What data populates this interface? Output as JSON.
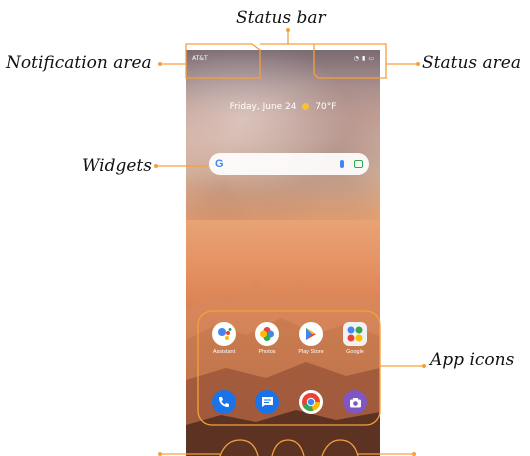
{
  "callouts": {
    "status_bar": "Status bar",
    "notification_area": "Notification area",
    "status_area": "Status area",
    "widgets": "Widgets",
    "app_icons": "App icons"
  },
  "phone": {
    "carrier": "AT&T",
    "date": "Friday, June 24",
    "temperature": "70°F",
    "search_logo": "G",
    "apps": [
      {
        "label": "Assistant",
        "icon": "assistant-icon"
      },
      {
        "label": "Photos",
        "icon": "photos-icon"
      },
      {
        "label": "Play Store",
        "icon": "play-store-icon"
      },
      {
        "label": "Google",
        "icon": "google-folder-icon"
      }
    ],
    "dock": [
      {
        "icon": "phone-icon"
      },
      {
        "icon": "messages-icon"
      },
      {
        "icon": "chrome-icon"
      },
      {
        "icon": "camera-icon"
      }
    ]
  },
  "colors": {
    "callout_line": "#f5a03c",
    "accent": "#f5a03c"
  }
}
